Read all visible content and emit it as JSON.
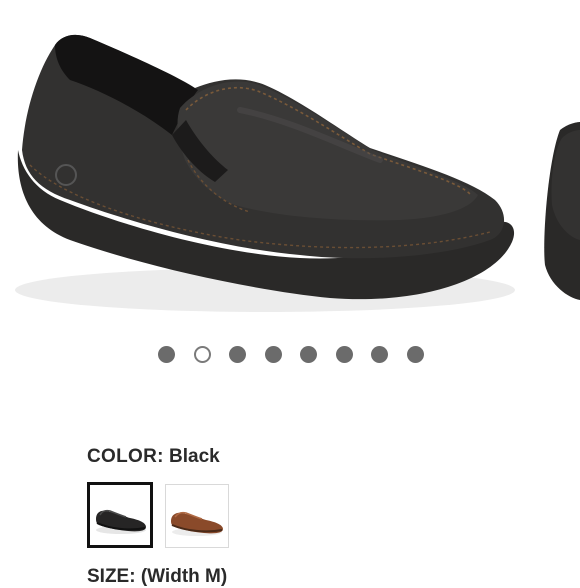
{
  "gallery": {
    "slide_count": 8,
    "active_index": 1,
    "main_image": "black-leather-slip-on-loafer"
  },
  "color": {
    "label": "COLOR:",
    "value": "Black",
    "swatches": [
      {
        "name": "black-loafer-swatch",
        "color": "#1f1f1f",
        "selected": true
      },
      {
        "name": "brown-loafer-swatch",
        "color": "#8a4a2a",
        "selected": false
      }
    ]
  },
  "size": {
    "label": "SIZE: (Width M)"
  }
}
